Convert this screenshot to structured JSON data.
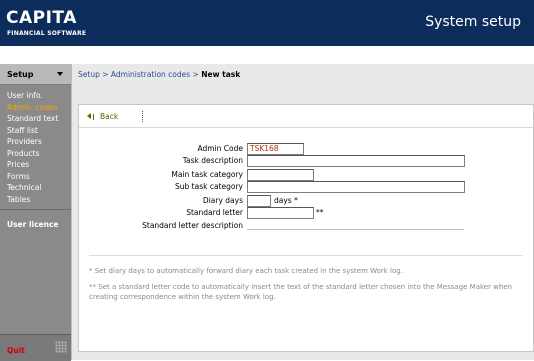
{
  "header": {
    "logo_main": "CAPITA",
    "logo_sub": "FINANCIAL SOFTWARE",
    "title": "System setup",
    "bg_color": "#0c2c5c"
  },
  "sidebar": {
    "heading": "Setup",
    "items": [
      {
        "label": "User info.",
        "active": false
      },
      {
        "label": "Admin. codes",
        "active": true
      },
      {
        "label": "Standard text",
        "active": false
      },
      {
        "label": "Staff list",
        "active": false
      },
      {
        "label": "Providers",
        "active": false
      },
      {
        "label": "Products",
        "active": false
      },
      {
        "label": "Prices",
        "active": false
      },
      {
        "label": "Forms",
        "active": false
      },
      {
        "label": "Technical",
        "active": false
      },
      {
        "label": "Tables",
        "active": false
      }
    ],
    "licence": "User licence",
    "quit": "Quit",
    "active_color": "#f2a900",
    "quit_color": "#d40000"
  },
  "breadcrumb": {
    "setup": "Setup",
    "sep1": " > ",
    "admin": "Administration codes",
    "sep2": " > ",
    "current": "New task"
  },
  "toolbar": {
    "back_label": "Back"
  },
  "form": {
    "admin_code_label": "Admin Code",
    "admin_code_value": "TSK168",
    "task_description_label": "Task description",
    "task_description_value": "",
    "main_category_label": "Main task category",
    "main_category_value": "",
    "sub_category_label": "Sub task category",
    "sub_category_value": "",
    "diary_days_label": "Diary days",
    "diary_days_value": "",
    "diary_days_suffix": "days *",
    "standard_letter_label": "Standard letter",
    "standard_letter_value": "",
    "standard_letter_suffix": "**",
    "standard_letter_desc_label": "Standard letter description"
  },
  "notes": {
    "note1": "* Set diary days to automatically forward diary each task created in the system Work log.",
    "note2": "** Set a standard letter code to automatically insert the text of the standard letter chosen into the Message Maker when creating correspondence within the system Work log."
  }
}
